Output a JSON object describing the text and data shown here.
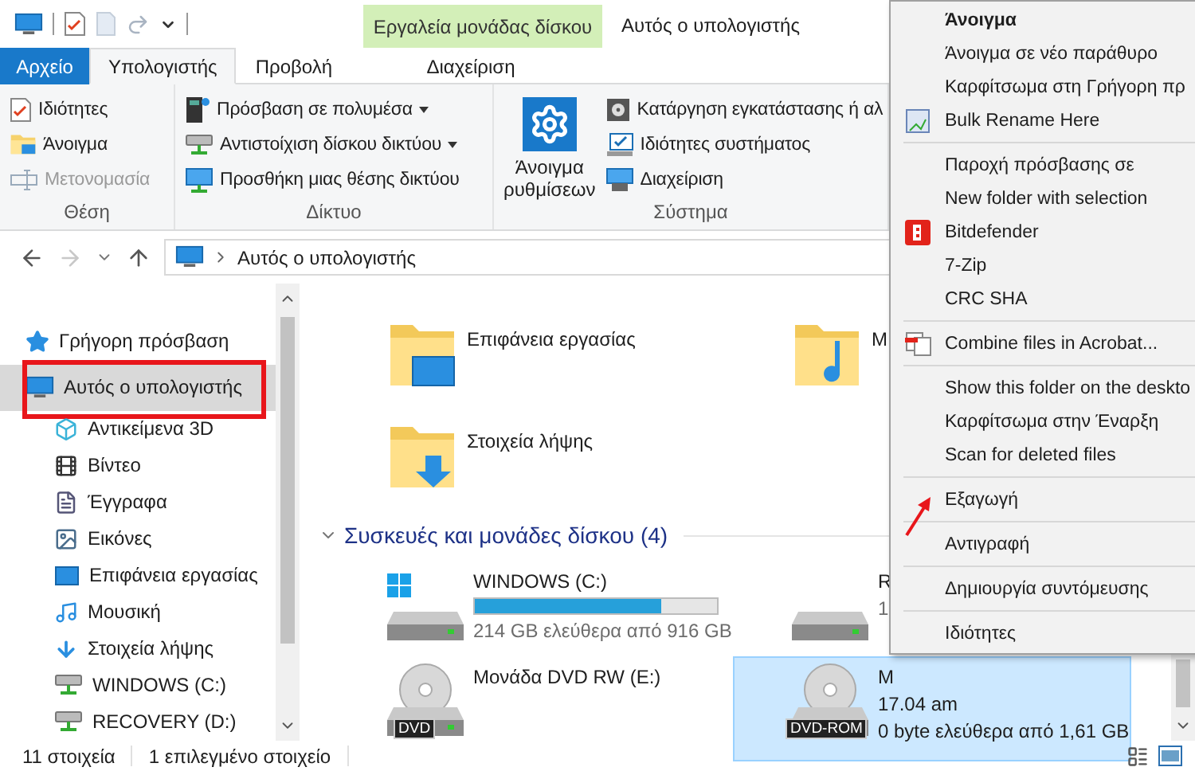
{
  "window": {
    "title": "Αυτός ο υπολογιστής",
    "context_tab_group": "Εργαλεία μονάδας δίσκου"
  },
  "ribbon_tabs": [
    {
      "label": "Αρχείο",
      "kind": "file",
      "selected": false
    },
    {
      "label": "Υπολογιστής",
      "kind": "tab",
      "selected": true
    },
    {
      "label": "Προβολή",
      "kind": "tab",
      "selected": false
    },
    {
      "label": "Διαχείριση",
      "kind": "context",
      "selected": false
    }
  ],
  "ribbon_groups": [
    {
      "label": "Θέση",
      "items": [
        {
          "label": "Ιδιότητες",
          "disabled": false,
          "dropdown": false
        },
        {
          "label": "Άνοιγμα",
          "disabled": false,
          "dropdown": false
        },
        {
          "label": "Μετονομασία",
          "disabled": true,
          "dropdown": false
        }
      ]
    },
    {
      "label": "Δίκτυο",
      "items": [
        {
          "label": "Πρόσβαση σε πολυμέσα",
          "disabled": false,
          "dropdown": true
        },
        {
          "label": "Αντιστοίχιση δίσκου δικτύου",
          "disabled": false,
          "dropdown": true
        },
        {
          "label": "Προσθήκη μιας θέσης δικτύου",
          "disabled": false,
          "dropdown": false
        }
      ]
    },
    {
      "label": "Σύστημα",
      "large_button": "Άνοιγμα ρυθμίσεων",
      "items": [
        {
          "label": "Κατάργηση εγκατάστασης ή αλ",
          "disabled": false,
          "dropdown": false
        },
        {
          "label": "Ιδιότητες συστήματος",
          "disabled": false,
          "dropdown": false
        },
        {
          "label": "Διαχείριση",
          "disabled": false,
          "dropdown": false
        }
      ]
    }
  ],
  "address_bar": {
    "path": [
      "Αυτός ο υπολογιστής"
    ]
  },
  "navigation": [
    {
      "label": "Γρήγορη πρόσβαση",
      "selected": false,
      "highlighted": false
    },
    {
      "label": "Αυτός ο υπολογιστής",
      "selected": true,
      "highlighted": true,
      "children": [
        {
          "label": "Αντικείμενα 3D",
          "selected": false,
          "highlighted": false
        },
        {
          "label": "Βίντεο",
          "selected": false,
          "highlighted": false
        },
        {
          "label": "Έγγραφα",
          "selected": false,
          "highlighted": false
        },
        {
          "label": "Εικόνες",
          "selected": false,
          "highlighted": false
        },
        {
          "label": "Επιφάνεια εργασίας",
          "selected": false,
          "highlighted": false
        },
        {
          "label": "Μουσική",
          "selected": false,
          "highlighted": false
        },
        {
          "label": "Στοιχεία λήψης",
          "selected": false,
          "highlighted": false
        },
        {
          "label": "WINDOWS (C:)",
          "selected": false,
          "highlighted": false
        },
        {
          "label": "RECOVERY (D:)",
          "selected": false,
          "highlighted": false
        }
      ]
    }
  ],
  "folders": [
    {
      "name": "Επιφάνεια εργασίας"
    },
    {
      "name": "Μ"
    },
    {
      "name": "Στοιχεία λήψης"
    }
  ],
  "drives_group": {
    "title": "Συσκευές και μονάδες δίσκου (4)",
    "expanded": true
  },
  "drives": [
    {
      "kind": "disk",
      "name": "WINDOWS (C:)",
      "level": 0.77,
      "free": "214 GB ελεύθερα από 916 GB",
      "selected": false
    },
    {
      "kind": "disk",
      "name": "R",
      "free": "1",
      "selected": false
    },
    {
      "kind": "optical",
      "badge": "DVD",
      "name": "Μονάδα DVD RW (E:)",
      "selected": false
    },
    {
      "kind": "optical",
      "badge": "DVD-ROM",
      "name": "Μ",
      "subtitle": "17.04 am",
      "free": "0 byte ελεύθερα από 1,61 GB",
      "selected": true
    }
  ],
  "status_bar": {
    "items": "11 στοιχεία",
    "selection": "1 επιλεγμένο στοιχείο"
  },
  "context_menu": [
    {
      "kind": "item",
      "label": "Άνοιγμα",
      "default": true,
      "pointed": false
    },
    {
      "kind": "item",
      "label": "Άνοιγμα σε νέο παράθυρο",
      "default": false,
      "pointed": false
    },
    {
      "kind": "item",
      "label": "Καρφίτσωμα στη Γρήγορη πρ",
      "default": false,
      "pointed": false
    },
    {
      "kind": "item",
      "label": "Bulk Rename Here",
      "default": false,
      "pointed": false
    },
    {
      "kind": "separator"
    },
    {
      "kind": "item",
      "label": "Παροχή πρόσβασης σε",
      "default": false,
      "pointed": false
    },
    {
      "kind": "item",
      "label": "New folder with selection",
      "default": false,
      "pointed": false
    },
    {
      "kind": "item",
      "label": "Bitdefender",
      "default": false,
      "pointed": false
    },
    {
      "kind": "item",
      "label": "7-Zip",
      "default": false,
      "pointed": false
    },
    {
      "kind": "item",
      "label": "CRC SHA",
      "default": false,
      "pointed": false
    },
    {
      "kind": "separator"
    },
    {
      "kind": "item",
      "label": "Combine files in Acrobat...",
      "default": false,
      "pointed": false
    },
    {
      "kind": "separator"
    },
    {
      "kind": "item",
      "label": "Show this folder on the deskto",
      "default": false,
      "pointed": false
    },
    {
      "kind": "item",
      "label": "Καρφίτσωμα στην Έναρξη",
      "default": false,
      "pointed": false
    },
    {
      "kind": "item",
      "label": "Scan for deleted files",
      "default": false,
      "pointed": false
    },
    {
      "kind": "separator"
    },
    {
      "kind": "item",
      "label": "Εξαγωγή",
      "default": false,
      "pointed": true
    },
    {
      "kind": "separator"
    },
    {
      "kind": "item",
      "label": "Αντιγραφή",
      "default": false,
      "pointed": false
    },
    {
      "kind": "separator"
    },
    {
      "kind": "item",
      "label": "Δημιουργία συντόμευσης",
      "default": false,
      "pointed": false
    },
    {
      "kind": "separator"
    },
    {
      "kind": "item",
      "label": "Ιδιότητες",
      "default": false,
      "pointed": false
    }
  ]
}
